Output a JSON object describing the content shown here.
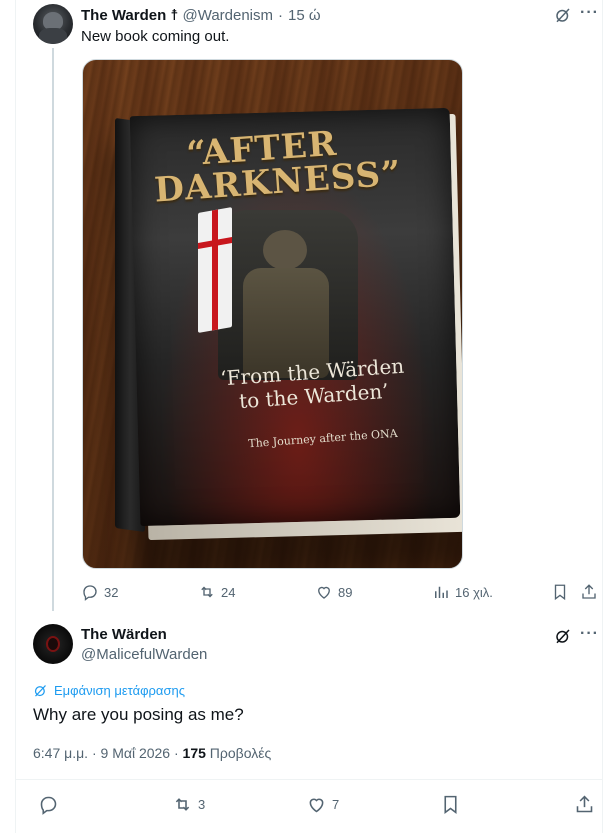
{
  "colors": {
    "muted": "#536471",
    "link": "#1d9bf0",
    "text": "#0f1419",
    "divider": "#eff3f4"
  },
  "tweet1": {
    "name": "The Warden",
    "badge": "☨",
    "handle": "@Wardenism",
    "separator": "·",
    "time": "15 ώ",
    "text": "New book coming out.",
    "media": {
      "cover_title_line1": "“AFTER",
      "cover_title_line2": "DARKNESS”",
      "cover_subtitle_line1": "‘From the Wärden",
      "cover_subtitle_line2": "to the Warden’",
      "cover_tagline": "The Journey after the ONA"
    },
    "stats": {
      "replies": "32",
      "reposts": "24",
      "likes": "89",
      "views": "16 χιλ."
    }
  },
  "tweet2": {
    "name": "The Wärden",
    "handle": "@MalicefulWarden",
    "translate_label": "Εμφάνιση μετάφρασης",
    "text": "Why are you posing as me?",
    "time": "6:47 μ.μ.",
    "date": "9 Μαΐ 2026",
    "separator": "·",
    "views_count": "175",
    "views_label": "Προβολές",
    "stats": {
      "reposts": "3",
      "likes": "7"
    }
  },
  "icons": {
    "grok": "grok-icon",
    "more": "more-icon",
    "reply": "reply-icon",
    "repost": "repost-icon",
    "like": "heart-icon",
    "views": "views-icon",
    "bookmark": "bookmark-icon",
    "share": "share-icon",
    "translate": "translate-icon"
  }
}
